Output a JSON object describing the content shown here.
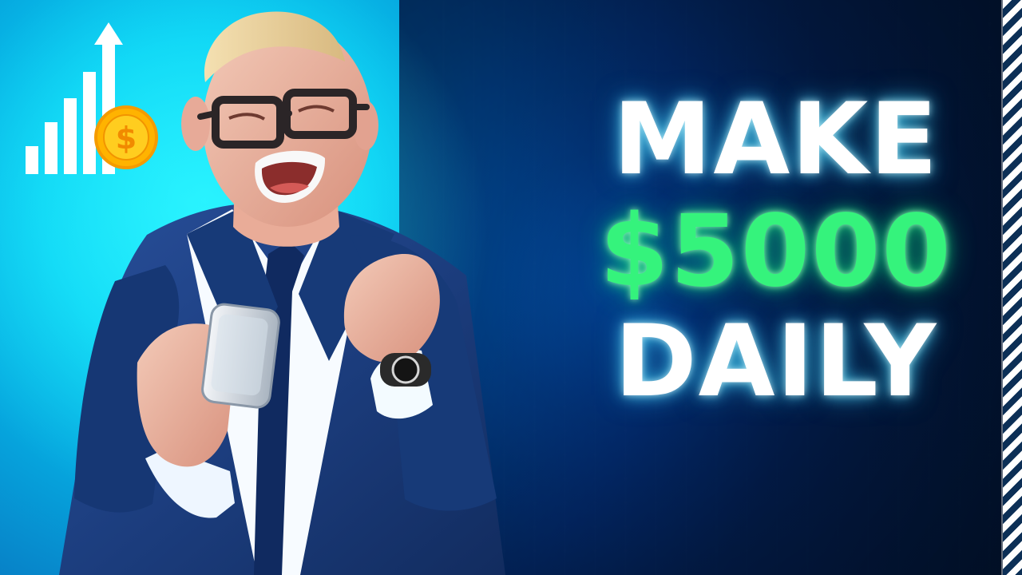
{
  "headline": {
    "line1": "MAKE",
    "line2": "$5000",
    "line3": "DAILY"
  },
  "icons": {
    "growth_chart": "bar-chart-up-icon",
    "coin": "dollar-coin-icon",
    "arrow": "arrow-up-icon"
  },
  "colors": {
    "accent_cyan": "#0ad0f4",
    "accent_green": "#35f37c",
    "background_blue": "#063766",
    "suit_blue": "#1f3f8a"
  }
}
